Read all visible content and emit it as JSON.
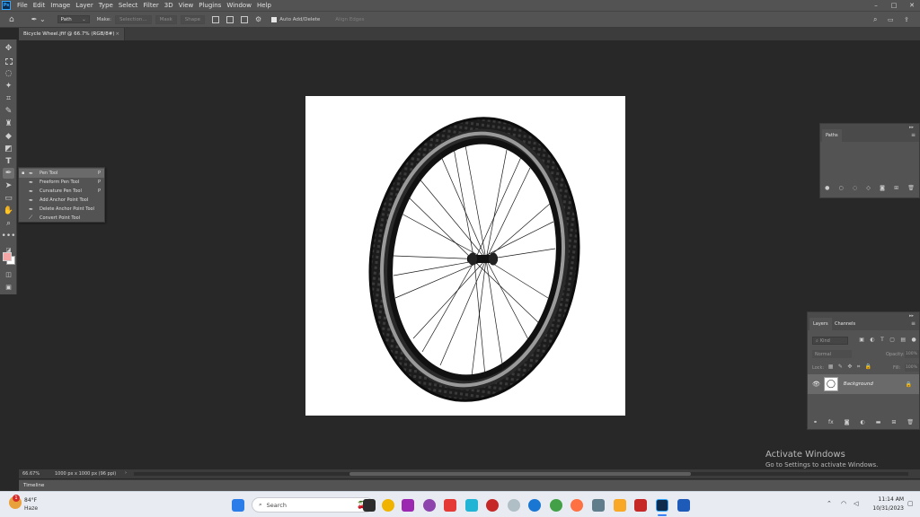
{
  "menubar": {
    "logo": "Ps",
    "items": [
      "File",
      "Edit",
      "Image",
      "Layer",
      "Type",
      "Select",
      "Filter",
      "3D",
      "View",
      "Plugins",
      "Window",
      "Help"
    ],
    "window_controls": [
      "–",
      "□",
      "✕"
    ]
  },
  "options": {
    "mode": "Path",
    "make_label": "Make:",
    "selection": "Selection...",
    "mask": "Mask",
    "shape": "Shape",
    "auto_add_delete": "Auto Add/Delete",
    "align_edges": "Align Edges"
  },
  "document": {
    "tab_title": "Bicycle Wheel.jfif @ 66.7% (RGB/8#)",
    "close": "×"
  },
  "tools": {
    "flyout": [
      {
        "label": "Pen Tool",
        "key": "P",
        "icon": "pen-icon",
        "selected": true
      },
      {
        "label": "Freeform Pen Tool",
        "key": "P",
        "icon": "freeform-pen-icon",
        "selected": false
      },
      {
        "label": "Curvature Pen Tool",
        "key": "P",
        "icon": "curvature-pen-icon",
        "selected": false
      },
      {
        "label": "Add Anchor Point Tool",
        "key": "",
        "icon": "add-anchor-icon",
        "selected": false
      },
      {
        "label": "Delete Anchor Point Tool",
        "key": "",
        "icon": "delete-anchor-icon",
        "selected": false
      },
      {
        "label": "Convert Point Tool",
        "key": "",
        "icon": "convert-point-icon",
        "selected": false
      }
    ]
  },
  "paths_panel": {
    "tab": "Paths"
  },
  "layers_panel": {
    "tabs": [
      "Layers",
      "Channels"
    ],
    "search_placeholder": "Kind",
    "blend_mode": "Normal",
    "opacity_label": "Opacity:",
    "opacity_value": "100%",
    "lock_label": "Lock:",
    "fill_label": "Fill:",
    "fill_value": "100%",
    "layer_name": "Background"
  },
  "status": {
    "zoom": "66.67%",
    "doc_size": "1000 px x 1000 px (96 ppi)"
  },
  "timeline": {
    "label": "Timeline"
  },
  "watermark": {
    "title": "Activate Windows",
    "subtitle": "Go to Settings to activate Windows."
  },
  "taskbar": {
    "weather_temp": "84°F",
    "weather_desc": "Haze",
    "weather_badge": "1",
    "search_placeholder": "Search",
    "time": "11:14 AM",
    "date": "10/31/2023"
  },
  "colors": {
    "menubar": "#535353",
    "workspace": "#282828",
    "accent": "#31a8ff",
    "foreground_swatch": "#f4a6a6"
  }
}
